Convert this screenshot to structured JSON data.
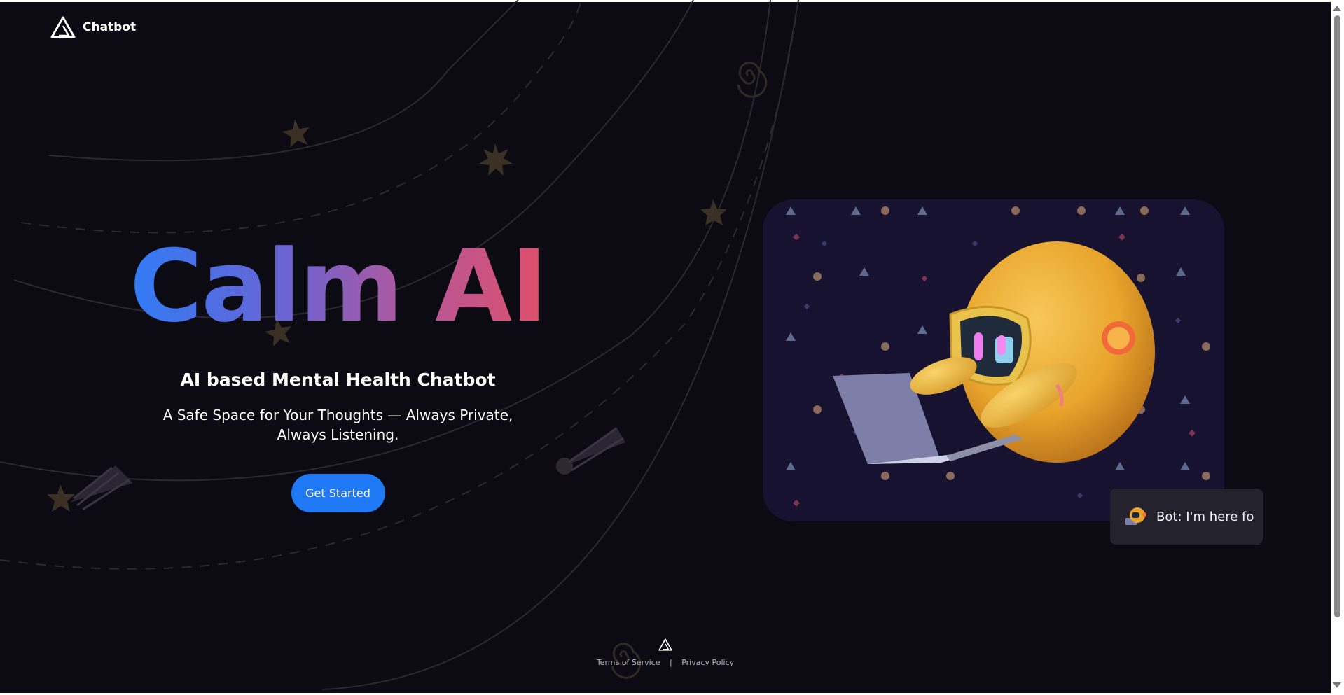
{
  "header": {
    "brand": "Chatbot",
    "logo_icon": "triangle-logo-icon"
  },
  "hero": {
    "title": "Calm AI",
    "subtitle": "AI based Mental Health Chatbot",
    "description": "A Safe Space for Your Thoughts — Always Private, Always Listening.",
    "cta_label": "Get Started"
  },
  "illustration": {
    "subject": "robot-with-laptop-illustration"
  },
  "chat_preview": {
    "text": "Bot: I'm here fo"
  },
  "footer": {
    "terms": "Terms of Service",
    "separator": "|",
    "privacy": "Privacy Policy"
  },
  "colors": {
    "background": "#0c0b14",
    "accent": "#1f78f4",
    "title_gradient": [
      "#2f7cf6",
      "#6b63d2",
      "#b4579a",
      "#e0506a"
    ],
    "card_background": "#16122f",
    "robot": "#f0b23a"
  }
}
